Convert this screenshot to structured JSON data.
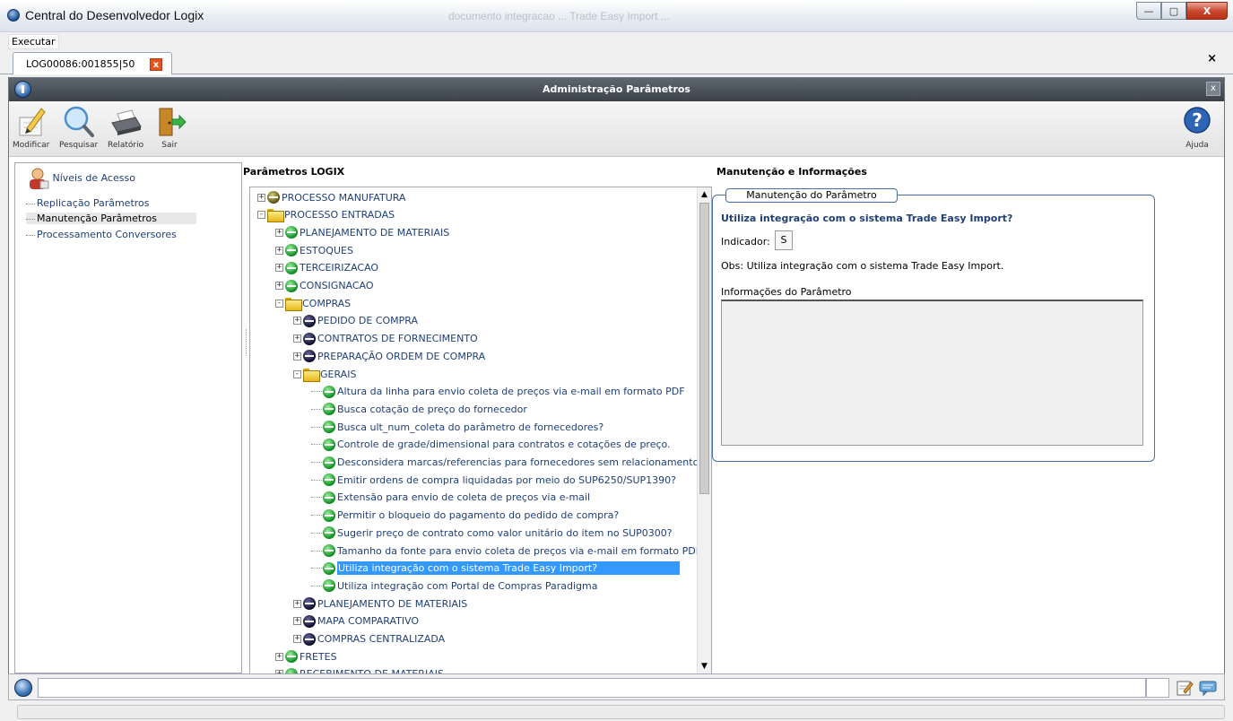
{
  "window": {
    "title": "Central do Desenvolvedor Logix",
    "blurred_title": "documento integracao ... Trade Easy Import ...",
    "min": "—",
    "max": "▢",
    "close": "X"
  },
  "menu": {
    "executar": "Executar"
  },
  "tab": {
    "label": "LOG00086:001855|50",
    "close": "x",
    "global_close": "×"
  },
  "inner": {
    "title": "Administração Parâmetros",
    "close": "x"
  },
  "toolbar": {
    "modificar": "Modificar",
    "pesquisar": "Pesquisar",
    "relatorio": "Relatório",
    "sair": "Sair",
    "ajuda": "Ajuda"
  },
  "leftnav": {
    "niveis": "Níveis de Acesso",
    "replicacao": "Replicação Parâmetros",
    "manutencao": "Manutenção Parâmetros",
    "processamento": "Processamento Conversores"
  },
  "tree_heading": "Parâmetros LOGIX",
  "right_heading": "Manutenção e Informações",
  "tree": [
    {
      "label": "PROCESSO MANUFATURA",
      "level": 0,
      "icon": "olive",
      "exp": "+"
    },
    {
      "label": "PROCESSO ENTRADAS",
      "level": 0,
      "icon": "folder",
      "exp": "-"
    },
    {
      "label": "PLANEJAMENTO DE MATERIAIS",
      "level": 1,
      "icon": "green",
      "exp": "+"
    },
    {
      "label": "ESTOQUES",
      "level": 1,
      "icon": "green",
      "exp": "+"
    },
    {
      "label": "TERCEIRIZACAO",
      "level": 1,
      "icon": "green",
      "exp": "+"
    },
    {
      "label": "CONSIGNACAO",
      "level": 1,
      "icon": "green",
      "exp": "+"
    },
    {
      "label": "COMPRAS",
      "level": 1,
      "icon": "folder",
      "exp": "-"
    },
    {
      "label": "PEDIDO DE COMPRA",
      "level": 2,
      "icon": "dark",
      "exp": "+"
    },
    {
      "label": "CONTRATOS DE FORNECIMENTO",
      "level": 2,
      "icon": "dark",
      "exp": "+"
    },
    {
      "label": "PREPARAÇÃO ORDEM DE COMPRA",
      "level": 2,
      "icon": "dark",
      "exp": "+"
    },
    {
      "label": "GERAIS",
      "level": 2,
      "icon": "folder",
      "exp": "-"
    },
    {
      "label": "Altura da linha para envio coleta de preços via e-mail em formato PDF",
      "level": 3,
      "icon": "green",
      "exp": ""
    },
    {
      "label": "Busca cotação de preço do fornecedor",
      "level": 3,
      "icon": "green",
      "exp": ""
    },
    {
      "label": "Busca ult_num_coleta do parâmetro de fornecedores?",
      "level": 3,
      "icon": "green",
      "exp": ""
    },
    {
      "label": "Controle de grade/dimensional para contratos e cotações de preço.",
      "level": 3,
      "icon": "green",
      "exp": ""
    },
    {
      "label": "Desconsidera marcas/referencias para fornecedores sem relacionamento",
      "level": 3,
      "icon": "green",
      "exp": ""
    },
    {
      "label": "Emitir ordens de compra liquidadas por meio do SUP6250/SUP1390?",
      "level": 3,
      "icon": "green",
      "exp": ""
    },
    {
      "label": "Extensão para envio de coleta de preços via e-mail",
      "level": 3,
      "icon": "green",
      "exp": ""
    },
    {
      "label": "Permitir o bloqueio do pagamento do pedido de compra?",
      "level": 3,
      "icon": "green",
      "exp": ""
    },
    {
      "label": "Sugerir preço de contrato como valor unitário do item no SUP0300?",
      "level": 3,
      "icon": "green",
      "exp": ""
    },
    {
      "label": "Tamanho da fonte para envio coleta de preços via e-mail em formato PDF",
      "level": 3,
      "icon": "green",
      "exp": ""
    },
    {
      "label": "Utiliza integração com o sistema Trade Easy Import?",
      "level": 3,
      "icon": "green",
      "exp": "",
      "selected": true
    },
    {
      "label": "Utiliza integração com Portal de Compras Paradigma",
      "level": 3,
      "icon": "green",
      "exp": ""
    },
    {
      "label": "PLANEJAMENTO DE MATERIAIS",
      "level": 2,
      "icon": "dark",
      "exp": "+"
    },
    {
      "label": "MAPA COMPARATIVO",
      "level": 2,
      "icon": "dark",
      "exp": "+"
    },
    {
      "label": "COMPRAS CENTRALIZADA",
      "level": 2,
      "icon": "dark",
      "exp": "+"
    },
    {
      "label": "FRETES",
      "level": 1,
      "icon": "green",
      "exp": "+"
    },
    {
      "label": "RECEBIMENTO DE MATERIAIS",
      "level": 1,
      "icon": "green",
      "exp": "+"
    }
  ],
  "param": {
    "legend": "Manutenção do Parâmetro",
    "question": "Utiliza integração com o sistema Trade Easy Import?",
    "indicator_label": "Indicador:",
    "indicator_value": "S",
    "obs": "Obs: Utiliza integração com o sistema Trade Easy Import.",
    "info_label": "Informações do Parâmetro"
  },
  "scroll": {
    "up": "▲",
    "down": "▼"
  }
}
